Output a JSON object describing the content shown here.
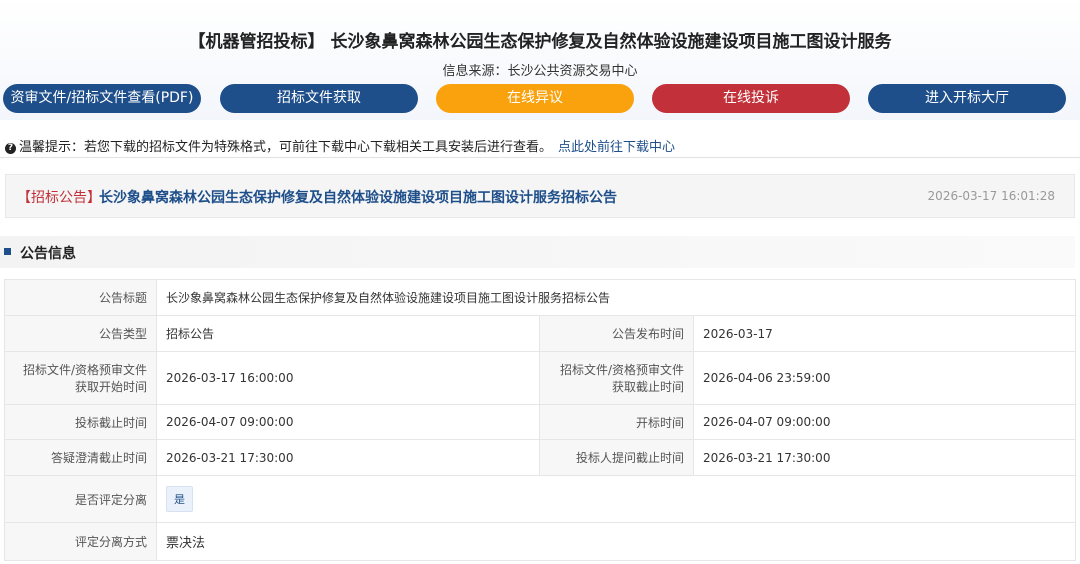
{
  "header": {
    "title": "【机器管招投标】 长沙象鼻窝森林公园生态保护修复及自然体验设施建设项目施工图设计服务",
    "source": "信息来源：长沙公共资源交易中心"
  },
  "buttons": {
    "view_docs": "资审文件/招标文件查看(PDF)",
    "get_docs": "招标文件获取",
    "online_objection": "在线异议",
    "online_complaint": "在线投诉",
    "enter_hall": "进入开标大厅"
  },
  "tip": {
    "icon": "question-circle-icon",
    "text": "温馨提示：若您下载的招标文件为特殊格式，可前往下载中心下载相关工具安装后进行查看。",
    "link": "点此处前往下载中心"
  },
  "announcement": {
    "tag": "【招标公告】",
    "title": "长沙象鼻窝森林公园生态保护修复及自然体验设施建设项目施工图设计服务招标公告",
    "datetime": "2026-03-17 16:01:28"
  },
  "section": {
    "title": "公告信息"
  },
  "info": {
    "title_label": "公告标题",
    "title_value": "长沙象鼻窝森林公园生态保护修复及自然体验设施建设项目施工图设计服务招标公告",
    "type_label": "公告类型",
    "type_value": "招标公告",
    "publish_label": "公告发布时间",
    "publish_value": "2026-03-17",
    "doc_start_label": "招标文件/资格预审文件获取开始时间",
    "doc_start_value": "2026-03-17 16:00:00",
    "doc_end_label": "招标文件/资格预审文件获取截止时间",
    "doc_end_value": "2026-04-06 23:59:00",
    "bid_deadline_label": "投标截止时间",
    "bid_deadline_value": "2026-04-07 09:00:00",
    "opening_label": "开标时间",
    "opening_value": "2026-04-07 09:00:00",
    "clarify_label": "答疑澄清截止时间",
    "clarify_value": "2026-03-21 17:30:00",
    "question_label": "投标人提问截止时间",
    "question_value": "2026-03-21 17:30:00",
    "separate_label": "是否评定分离",
    "separate_value": "是",
    "method_label": "评定分离方式",
    "method_value": "票决法"
  }
}
